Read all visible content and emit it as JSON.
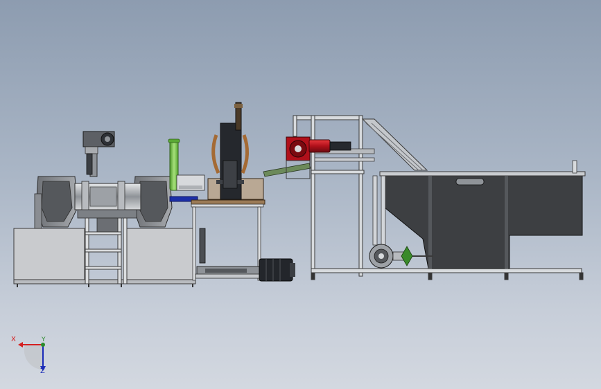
{
  "scene": {
    "background_top": "#8d9cb0",
    "background_bottom": "#d3d8e0"
  },
  "triad": {
    "x_label": "X",
    "y_label": "Y",
    "z_label": "Z",
    "x_color": "#d42020",
    "y_color": "#2a8a2a",
    "z_color": "#1a2ab8"
  },
  "colors": {
    "frame": "#cfd2d6",
    "frame_edge": "#3a3a3a",
    "tank": "#3d3f42",
    "motor_red": "#c8141c",
    "green_cylinder": "#7ac94a",
    "wood": "#9b7a56",
    "blue_plate": "#1c2fa8",
    "dark_machine": "#23262b"
  }
}
